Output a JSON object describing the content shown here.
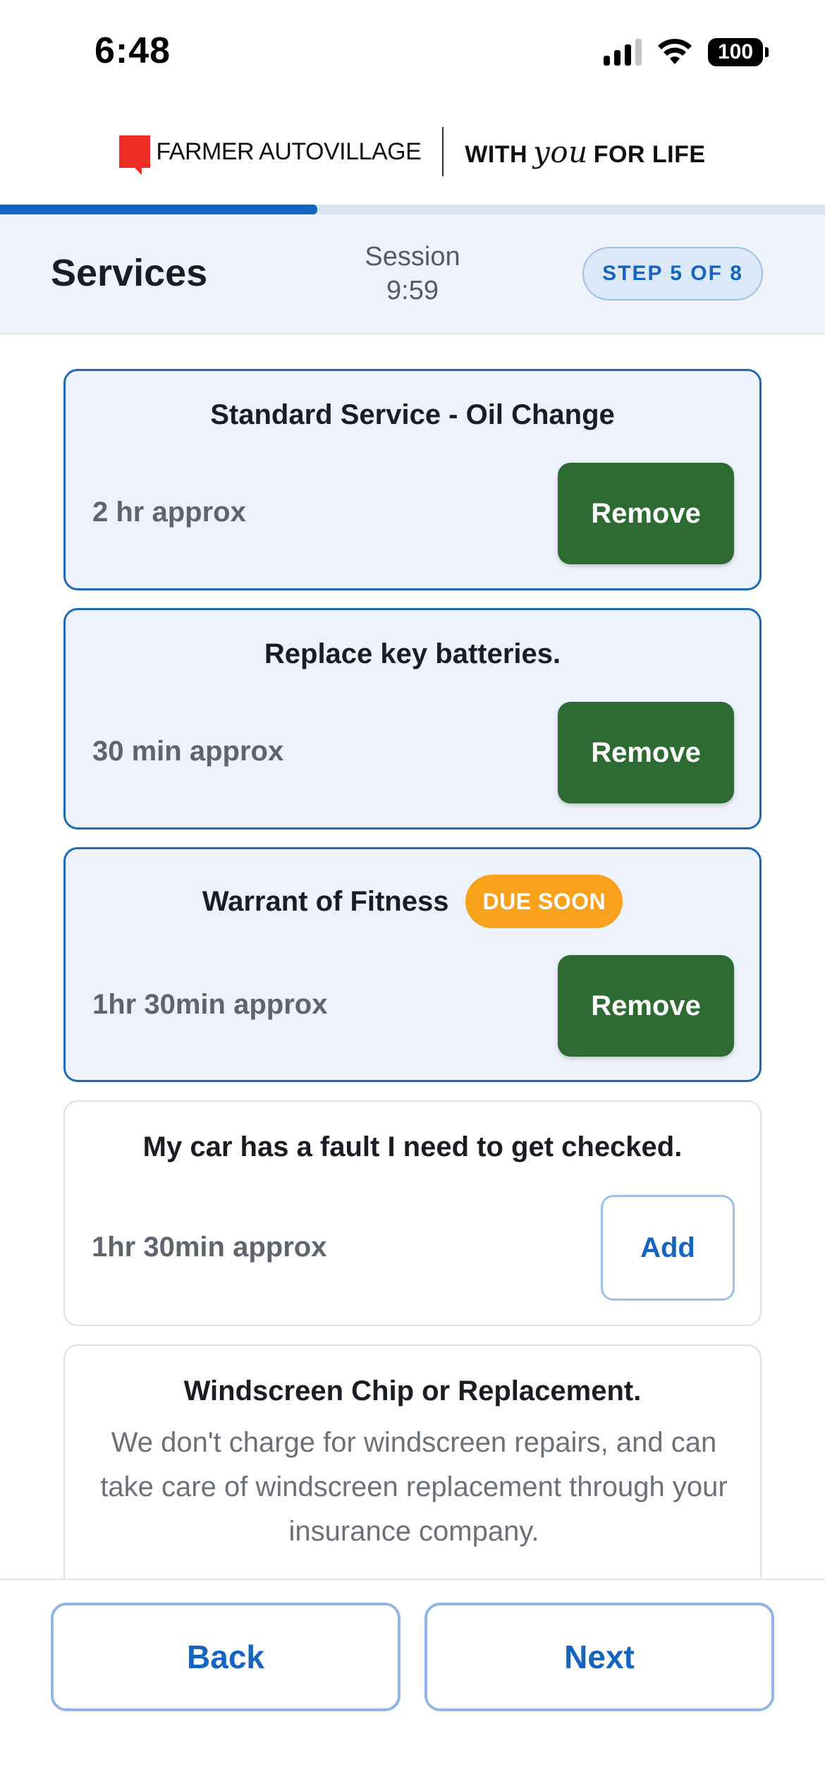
{
  "status_bar": {
    "time": "6:48",
    "battery": "100"
  },
  "brand": {
    "name_bold": "FARMER",
    "name_rest": "AUTOVILLAGE",
    "tagline_pre": "WITH",
    "tagline_script": "you",
    "tagline_post": "FOR LIFE"
  },
  "progress": {
    "fraction": 0.385
  },
  "header": {
    "title": "Services",
    "session_label": "Session",
    "session_time": "9:59",
    "step": "STEP 5 OF 8"
  },
  "services": [
    {
      "title": "Standard Service - Oil Change",
      "duration": "2 hr approx",
      "action": "Remove",
      "selected": true
    },
    {
      "title": "Replace key batteries.",
      "duration": "30 min approx",
      "action": "Remove",
      "selected": true
    },
    {
      "title": "Warrant of Fitness",
      "badge": "DUE SOON",
      "duration": "1hr 30min approx",
      "action": "Remove",
      "selected": true
    },
    {
      "title": "My car has a fault I need to get checked.",
      "duration": "1hr 30min approx",
      "action": "Add",
      "selected": false
    },
    {
      "title": "Windscreen Chip or Replacement.",
      "description": "We don't charge for windscreen repairs, and can take care of windscreen replacement through your insurance company.",
      "selected": false
    }
  ],
  "footer": {
    "back_label": "Back",
    "next_label": "Next"
  },
  "colors": {
    "accent": "#1565c0",
    "remove_green": "#2e6b33",
    "due_orange": "#f8a11a",
    "brand_red": "#ee2d24"
  }
}
